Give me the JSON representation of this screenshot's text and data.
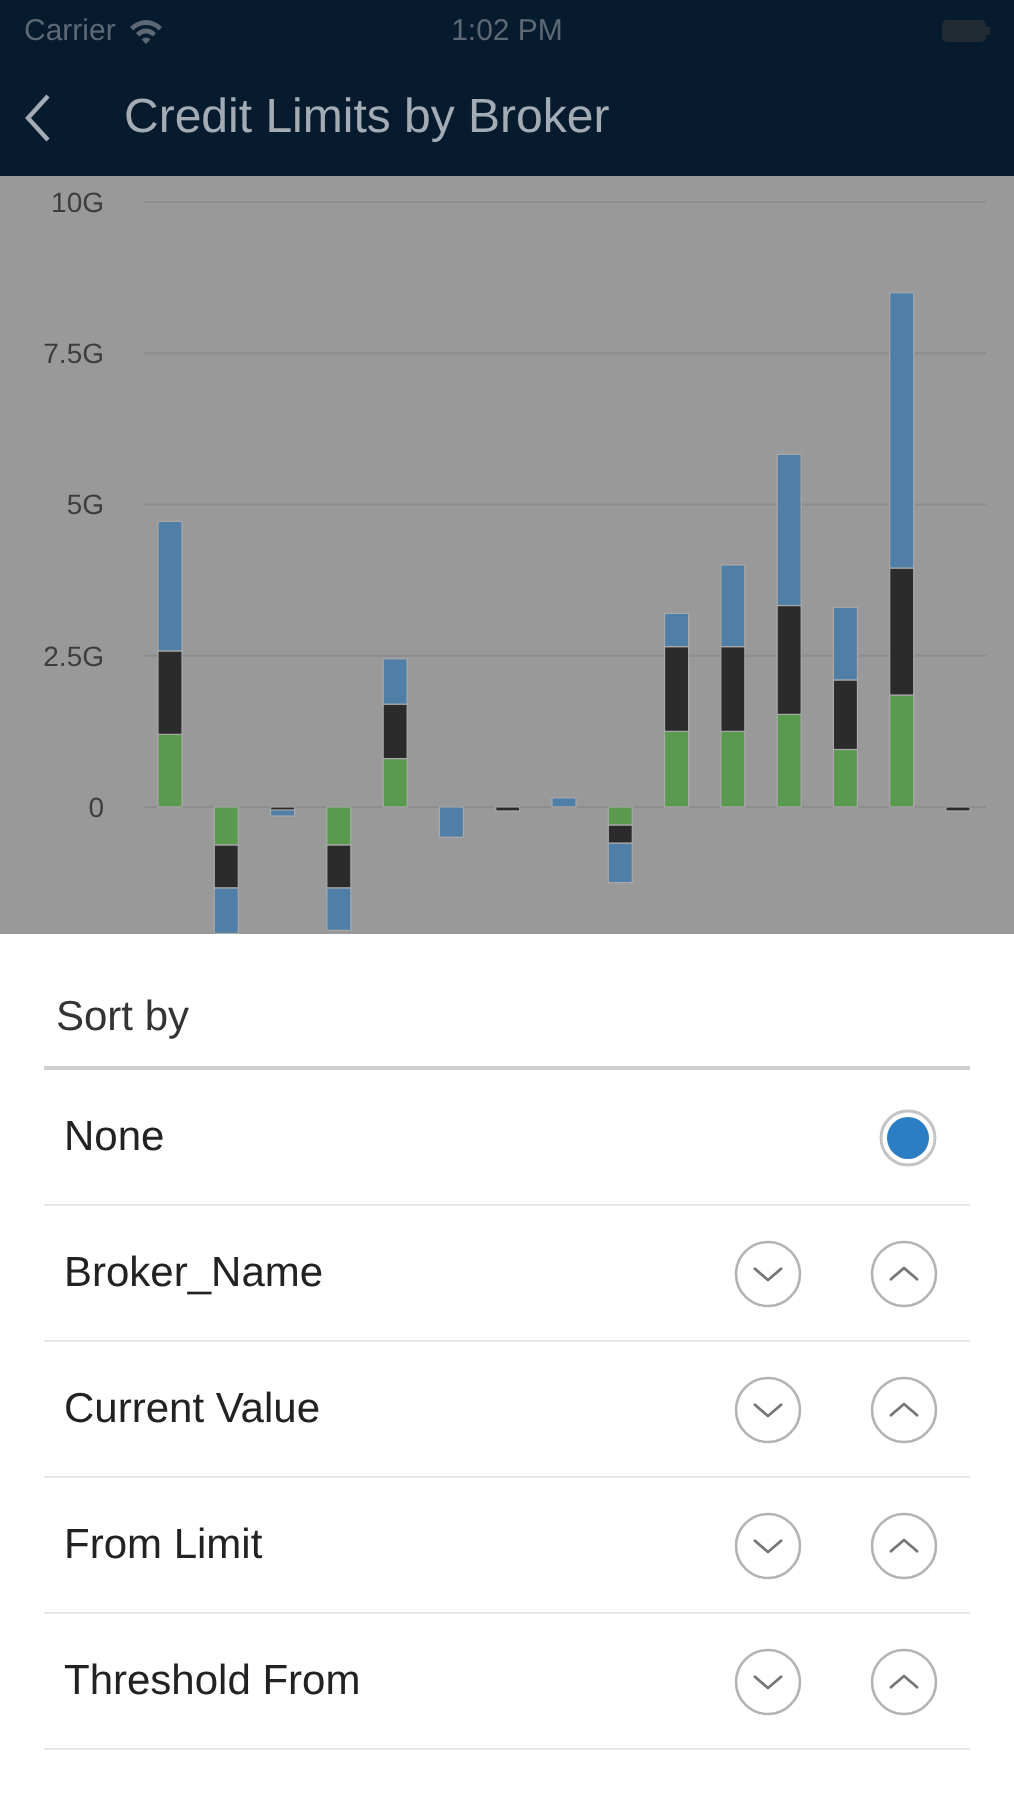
{
  "status_bar": {
    "carrier": "Carrier",
    "time": "1:02 PM"
  },
  "nav_bar": {
    "title": "Credit Limits by Broker"
  },
  "chart": {
    "chart_data": {
      "type": "bar",
      "stacked": true,
      "grid": true,
      "series": [
        {
          "color": "#5a9a4f",
          "values": [
            1.2,
            -0.63,
            0,
            -0.63,
            0.8,
            0,
            0,
            0,
            -0.3,
            1.25,
            1.25,
            1.53,
            0.95,
            1.85,
            0
          ]
        },
        {
          "color": "#2b2b2b",
          "values": [
            1.38,
            -0.71,
            -0.05,
            -0.71,
            0.9,
            0,
            -0.05,
            0,
            -0.3,
            1.4,
            1.4,
            1.8,
            1.15,
            2.1,
            -0.05
          ]
        },
        {
          "color": "#4f7ea6",
          "values": [
            2.14,
            -0.75,
            -0.1,
            -0.7,
            0.75,
            -0.5,
            0,
            0.15,
            -0.65,
            0.55,
            1.35,
            2.5,
            1.2,
            4.55,
            0
          ]
        }
      ],
      "ylim": [
        -2.1,
        10
      ],
      "yticks": [
        0,
        {
          "value": 2.5,
          "label": "2.5G"
        },
        {
          "value": 5,
          "label": "5G"
        },
        {
          "value": 7.5,
          "label": "7.5G"
        },
        {
          "value": 10,
          "label": "10G"
        }
      ]
    }
  },
  "sort_sheet": {
    "title": "Sort by",
    "rows": [
      {
        "label": "None",
        "kind": "radio",
        "selected": true
      },
      {
        "label": "Broker_Name",
        "kind": "sort",
        "selected": false
      },
      {
        "label": "Current Value",
        "kind": "sort",
        "selected": false
      },
      {
        "label": "From Limit",
        "kind": "sort",
        "selected": false
      },
      {
        "label": "Threshold From",
        "kind": "sort",
        "selected": false
      }
    ]
  }
}
